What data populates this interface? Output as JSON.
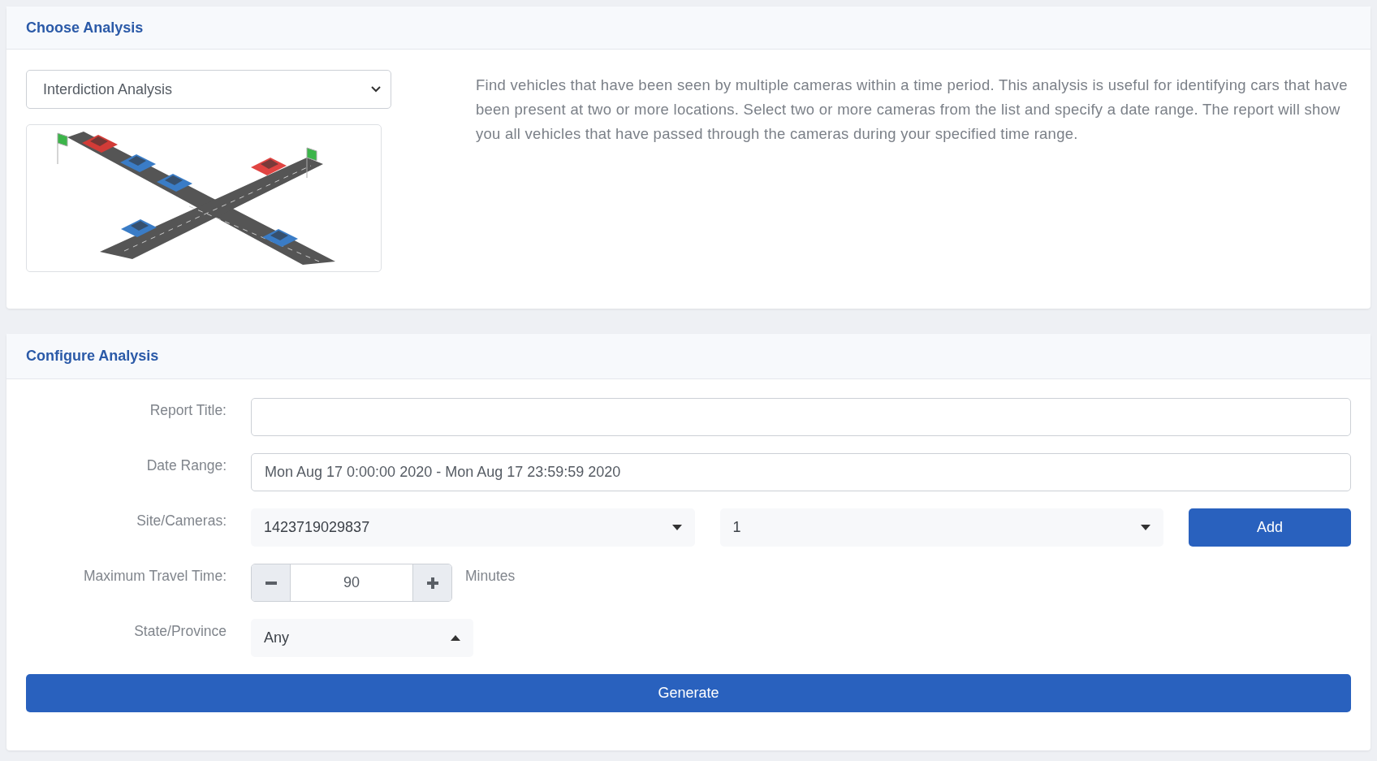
{
  "choose_analysis": {
    "title": "Choose Analysis",
    "analysis_select": {
      "value": "Interdiction Analysis"
    },
    "illustration": {
      "kind": "drawing"
    },
    "description": "Find vehicles that have been seen by multiple cameras within a time period. This analysis is useful for identifying cars that have been present at two or more locations. Select two or more cameras from the list and specify a date range. The report will show you all vehicles that have passed through the cameras during your specified time range."
  },
  "configure_analysis": {
    "title": "Configure Analysis",
    "report_title": {
      "label": "Report Title:"
    },
    "date_range": {
      "label": "Date Range:",
      "value": "Mon Aug 17 0:00:00 2020 - Mon Aug 17 23:59:59 2020"
    },
    "site_cameras": {
      "label": "Site/Cameras:",
      "site": "1423719029837",
      "camera": "1",
      "add_button": "Add"
    },
    "max_travel_time": {
      "label": "Maximum Travel Time:",
      "value": "90",
      "unit": "Minutes"
    },
    "state_province": {
      "label": "State/Province",
      "value": "Any",
      "expanded": true
    },
    "generate_button": "Generate"
  }
}
